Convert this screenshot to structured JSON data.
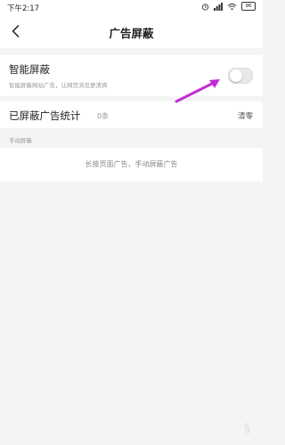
{
  "status_bar": {
    "time": "下午2:17",
    "battery": "96"
  },
  "header": {
    "title": "广告屏蔽"
  },
  "smart_block": {
    "title": "智能屏蔽",
    "subtitle": "智能屏蔽网站广告，让网页浏览更清爽",
    "enabled": false
  },
  "stats": {
    "label": "已屏蔽广告统计",
    "count": "0条",
    "clear_label": "清零"
  },
  "manual_section": {
    "header": "手动屏蔽",
    "hint": "长按页面广告，手动屏蔽广告"
  },
  "colors": {
    "arrow": "#c22bd6",
    "background": "#f4f4f4"
  }
}
